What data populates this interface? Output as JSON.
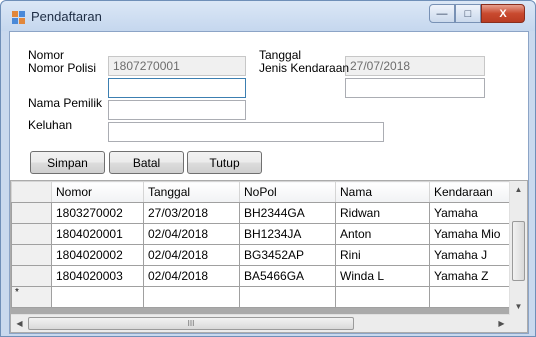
{
  "window": {
    "title": "Pendaftaran",
    "minimize_glyph": "—",
    "maximize_glyph": "□",
    "close_glyph": "X"
  },
  "form": {
    "nomor_label": "Nomor",
    "nomor_value": "1807270001",
    "nomor_polisi_label": "Nomor Polisi",
    "nomor_polisi_value": "",
    "nama_pemilik_label": "Nama Pemilik",
    "nama_pemilik_value": "",
    "keluhan_label": "Keluhan",
    "keluhan_value": "",
    "tanggal_label": "Tanggal",
    "tanggal_value": "27/07/2018",
    "jenis_kendaraan_label": "Jenis Kendaraan",
    "jenis_kendaraan_value": ""
  },
  "buttons": {
    "simpan": "Simpan",
    "batal": "Batal",
    "tutup": "Tutup"
  },
  "grid": {
    "columns": [
      "Nomor",
      "Tanggal",
      "NoPol",
      "Nama",
      "Kendaraan"
    ],
    "rows": [
      [
        "1803270002",
        "27/03/2018",
        "BH2344GA",
        "Ridwan",
        "Yamaha"
      ],
      [
        "1804020001",
        "02/04/2018",
        "BH1234JA",
        "Anton",
        "Yamaha Mio"
      ],
      [
        "1804020002",
        "02/04/2018",
        "BG3452AP",
        "Rini",
        "Yamaha J"
      ],
      [
        "1804020003",
        "02/04/2018",
        "BA5466GA",
        "Winda L",
        "Yamaha Z"
      ]
    ],
    "new_row_marker": "*",
    "scroll_up_glyph": "▲",
    "scroll_down_glyph": "▼",
    "scroll_left_glyph": "◀",
    "scroll_right_glyph": "▶",
    "hthumb_grip": "III"
  },
  "colors": {
    "title_bar": "#c5d7ee",
    "close_button": "#c94a2f",
    "grid_background": "#aaaaaa",
    "readonly_field": "#f0f0f0"
  }
}
